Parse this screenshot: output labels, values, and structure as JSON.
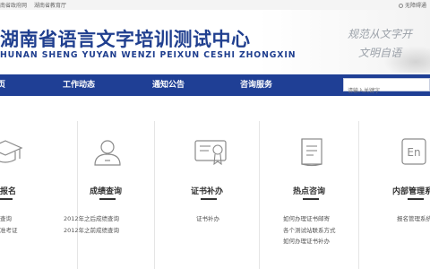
{
  "topbar": {
    "links": [
      "南省政府网",
      "湖南省教育厅"
    ],
    "accessibility": "无障碍通"
  },
  "header": {
    "title_cn": "湖南省语言文字培训测试中心",
    "title_en": "HUNAN SHENG YUYAN WENZI PEIXUN CESHI ZHONGXIN",
    "slogan_line1": "规范从文字开",
    "slogan_line2": "文明自语"
  },
  "nav": {
    "items": [
      "页",
      "工作动态",
      "通知公告",
      "咨询服务"
    ]
  },
  "search": {
    "placeholder": "请输入关键字"
  },
  "columns": [
    {
      "icon": "graduation-cap-icon",
      "title": "报名",
      "links": [
        "",
        "查询",
        "准考证"
      ]
    },
    {
      "icon": "user-icon",
      "title": "成绩查询",
      "links": [
        "2012年之后成绩查询",
        "2012年之前成绩查询"
      ]
    },
    {
      "icon": "certificate-icon",
      "title": "证书补办",
      "links": [
        "证书补办"
      ]
    },
    {
      "icon": "document-icon",
      "title": "热点咨询",
      "links": [
        "如何办理证书邮寄",
        "各个测试站联系方式",
        "如何办理证书补办"
      ]
    },
    {
      "icon": "en-box-icon",
      "title": "内部管理系",
      "links": [
        "报名管理系统"
      ]
    }
  ]
}
